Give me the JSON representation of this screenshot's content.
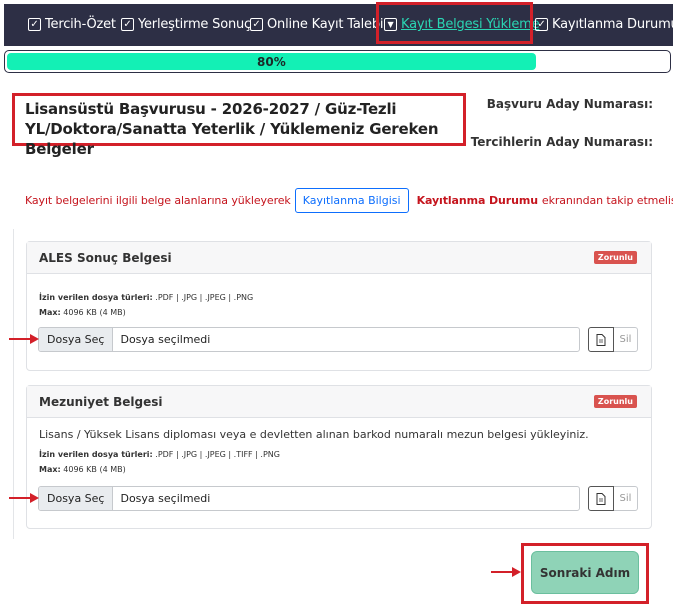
{
  "steps": [
    {
      "label": "Tercih-Özet",
      "icon": "checkbox-checked-icon"
    },
    {
      "label": "Yerleştirme Sonuç",
      "icon": "checkbox-checked-icon"
    },
    {
      "label": "Online Kayıt Talebi",
      "icon": "checkbox-checked-icon"
    },
    {
      "label": "Kayıt Belgesi Yükleme",
      "icon": "dropdown-arrow-icon",
      "active": true
    },
    {
      "label": "Kayıtlanma Durumu",
      "icon": "checkbox-checked-icon"
    }
  ],
  "progress": {
    "percent": 80,
    "label": "80%"
  },
  "header": {
    "title_line1": "Lisansüstü Başvurusu - 2026-2027 / Güz-Tezli",
    "title_line2": "YL/Doktora/Sanatta Yeterlik / Yüklemeniz Gereken Belgeler",
    "basvuru_label": "Başvuru Aday Numarası:",
    "tercih_label": "Tercihlerin Aday Numarası:"
  },
  "info": {
    "before": "Kayıt belgelerini ilgili belge alanlarına yükleyerek",
    "button": "Kayıtlanma Bilgisi",
    "bold": "Kayıtlanma Durumu",
    "after": "ekranından takip etmelisiniz."
  },
  "cards": [
    {
      "title": "ALES Sonuç Belgesi",
      "badge": "Zorunlu",
      "description": "",
      "types_label": "İzin verilen dosya türleri:",
      "types": " .PDF | .JPG | .JPEG | .PNG",
      "max_label": "Max:",
      "max": " 4096 KB (4 MB)",
      "choose": "Dosya Seç",
      "status": "Dosya seçilmedi",
      "delete": "Sil"
    },
    {
      "title": "Mezuniyet Belgesi",
      "badge": "Zorunlu",
      "description": "Lisans / Yüksek Lisans diploması veya e devletten alınan barkod numaralı mezun belgesi yükleyiniz.",
      "types_label": "İzin verilen dosya türleri:",
      "types": " .PDF | .JPG | .JPEG | .TIFF | .PNG",
      "max_label": "Max:",
      "max": " 4096 KB (4 MB)",
      "choose": "Dosya Seç",
      "status": "Dosya seçilmedi",
      "delete": "Sil"
    }
  ],
  "next_button": "Sonraki Adım",
  "colors": {
    "accent": "#13f0b5",
    "highlight": "#d32029",
    "nav": "#2d2f45",
    "active_link": "#2ad6b4"
  }
}
